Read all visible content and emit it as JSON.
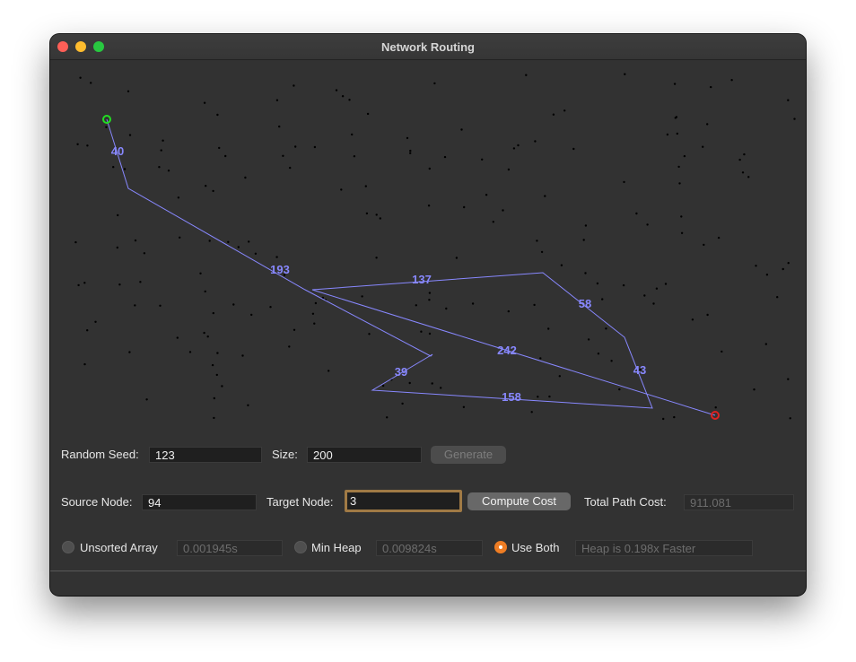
{
  "window": {
    "title": "Network Routing"
  },
  "graph": {
    "path_color": "#8888ff",
    "source_color": "#22dd22",
    "target_color": "#dd2222",
    "edge_labels": [
      "40",
      "193",
      "137",
      "58",
      "242",
      "43",
      "39",
      "158"
    ]
  },
  "controls": {
    "random_seed_label": "Random Seed:",
    "random_seed_value": "123",
    "size_label": "Size:",
    "size_value": "200",
    "generate_label": "Generate",
    "source_label": "Source Node:",
    "source_value": "94",
    "target_label": "Target Node:",
    "target_value": "3",
    "compute_label": "Compute Cost",
    "total_cost_label": "Total Path Cost:",
    "total_cost_value": "911.081"
  },
  "modes": {
    "unsorted_label": "Unsorted Array",
    "unsorted_time": "0.001945s",
    "minheap_label": "Min Heap",
    "minheap_time": "0.009824s",
    "both_label": "Use Both",
    "both_result": "Heap is 0.198x Faster",
    "selected": "both",
    "accent_color": "#ee7d24"
  }
}
